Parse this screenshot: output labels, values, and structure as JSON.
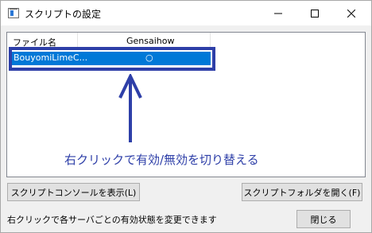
{
  "window": {
    "title": "スクリプトの設定",
    "controls": {
      "minimize": "minimize",
      "maximize": "maximize",
      "close": "close"
    }
  },
  "list": {
    "columns": [
      "ファイル名",
      "Gensaihow"
    ],
    "rows": [
      {
        "file": "BouyomiLimeC...",
        "status": "○",
        "selected": true
      }
    ]
  },
  "annotation": "右クリックで有効/無効を切り替える",
  "buttons": {
    "console": "スクリプトコンソールを表示(L)",
    "open_folder": "スクリプトフォルダを開く(F)",
    "close": "閉じる"
  },
  "status_text": "右クリックで各サーバごとの有効状態を変更できます",
  "colors": {
    "selection": "#0078d7",
    "annotation": "#2e3fa8"
  }
}
